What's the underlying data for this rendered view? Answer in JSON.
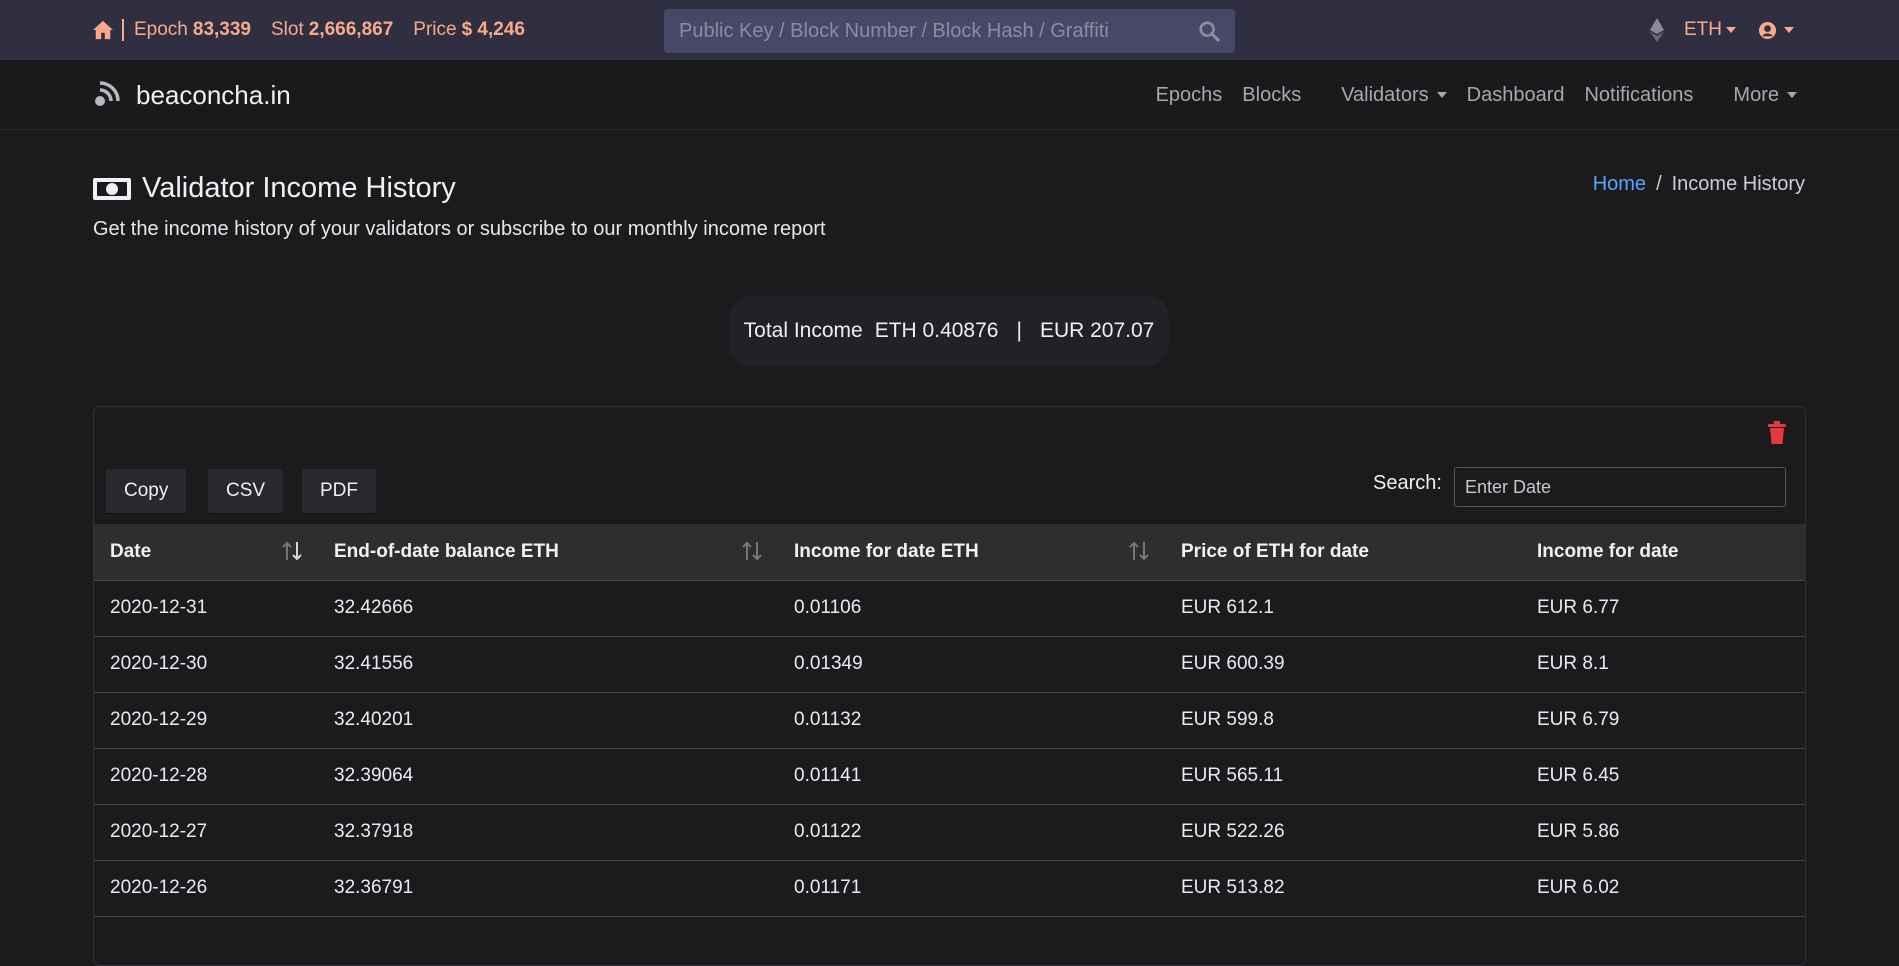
{
  "topbar": {
    "epoch_label": "Epoch",
    "epoch_value": "83,339",
    "slot_label": "Slot",
    "slot_value": "2,666,867",
    "price_label": "Price",
    "price_value": "$ 4,246",
    "search_placeholder": "Public Key / Block Number / Block Hash / Graffiti",
    "currency": "ETH",
    "accent_color": "#f8a98a"
  },
  "navbar": {
    "brand": "beaconcha.in",
    "links": [
      "Epochs",
      "Blocks",
      "Validators",
      "Dashboard",
      "Notifications",
      "More"
    ]
  },
  "page": {
    "title": "Validator Income History",
    "subtitle": "Get the income history of your validators or subscribe to our monthly income report",
    "breadcrumb_home": "Home",
    "breadcrumb_current": "Income History"
  },
  "total": {
    "label": "Total Income",
    "eth": "ETH 0.40876",
    "divider": "|",
    "eur": "EUR 207.07"
  },
  "table_controls": {
    "copy": "Copy",
    "csv": "CSV",
    "pdf": "PDF",
    "search_label": "Search:",
    "search_placeholder": "Enter Date"
  },
  "table": {
    "headers": [
      "Date",
      "End-of-date balance ETH",
      "Income for date ETH",
      "Price of ETH for date",
      "Income for date"
    ],
    "rows": [
      [
        "2020-12-31",
        "32.42666",
        "0.01106",
        "EUR 612.1",
        "EUR 6.77"
      ],
      [
        "2020-12-30",
        "32.41556",
        "0.01349",
        "EUR 600.39",
        "EUR 8.1"
      ],
      [
        "2020-12-29",
        "32.40201",
        "0.01132",
        "EUR 599.8",
        "EUR 6.79"
      ],
      [
        "2020-12-28",
        "32.39064",
        "0.01141",
        "EUR 565.11",
        "EUR 6.45"
      ],
      [
        "2020-12-27",
        "32.37918",
        "0.01122",
        "EUR 522.26",
        "EUR 5.86"
      ],
      [
        "2020-12-26",
        "32.36791",
        "0.01171",
        "EUR 513.82",
        "EUR 6.02"
      ]
    ]
  }
}
